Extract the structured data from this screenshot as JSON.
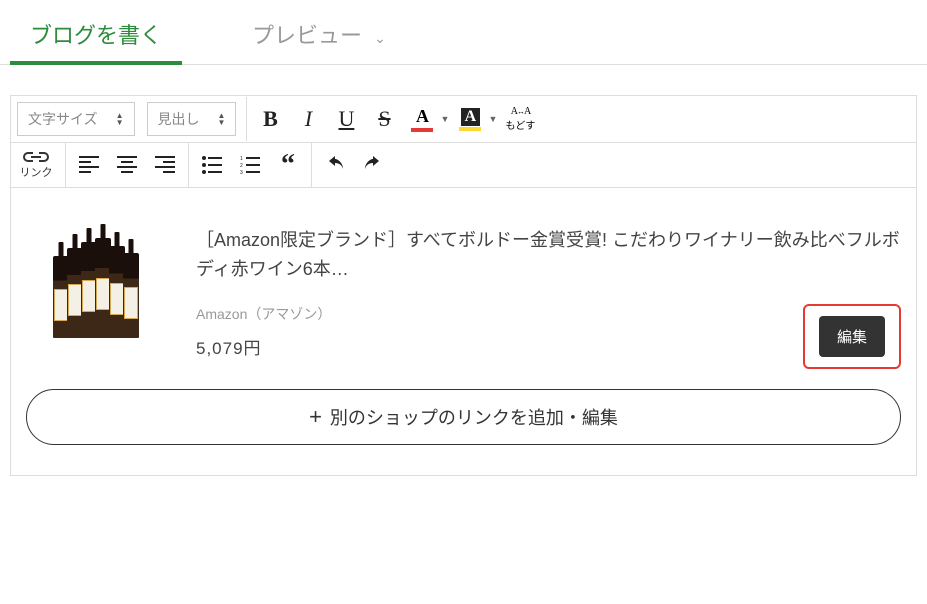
{
  "tabs": {
    "write": "ブログを書く",
    "preview": "プレビュー"
  },
  "toolbar": {
    "font_size": "文字サイズ",
    "heading": "見出し",
    "reset_top": "A→A",
    "reset_label": "もどす",
    "link_label": "リンク"
  },
  "product": {
    "title": "［Amazon限定ブランド］すべてボルドー金賞受賞! こだわりワイナリー飲み比べフルボディ赤ワイン6本…",
    "shop": "Amazon（アマゾン）",
    "price": "5,079円"
  },
  "buttons": {
    "edit": "編集",
    "add_link": "別のショップのリンクを追加・編集"
  }
}
